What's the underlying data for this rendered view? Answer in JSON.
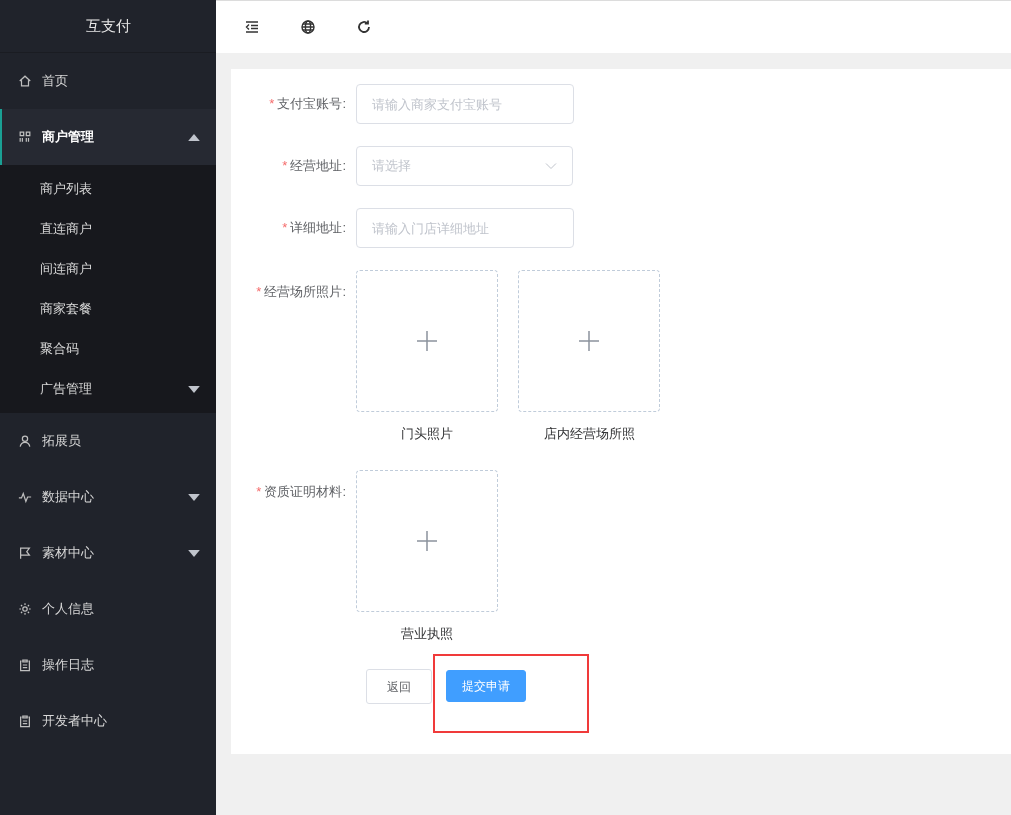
{
  "app": {
    "title": "互支付"
  },
  "sidebar": {
    "items": [
      {
        "label": "首页",
        "selected": false
      },
      {
        "label": "商户管理",
        "selected": true,
        "expanded": true,
        "children": [
          {
            "label": "商户列表"
          },
          {
            "label": "直连商户"
          },
          {
            "label": "间连商户"
          },
          {
            "label": "商家套餐"
          },
          {
            "label": "聚合码"
          },
          {
            "label": "广告管理",
            "expanded": false
          }
        ]
      },
      {
        "label": "拓展员",
        "selected": false
      },
      {
        "label": "数据中心",
        "selected": false,
        "expanded": false
      },
      {
        "label": "素材中心",
        "selected": false,
        "expanded": false
      },
      {
        "label": "个人信息",
        "selected": false
      },
      {
        "label": "操作日志",
        "selected": false
      },
      {
        "label": "开发者中心",
        "selected": false
      }
    ]
  },
  "form": {
    "fields": [
      {
        "kind": "input",
        "mark": "*",
        "label": "支付宝账号:",
        "placeholder": "请输入商家支付宝账号"
      },
      {
        "kind": "select",
        "mark": "*",
        "label": "经营地址:",
        "placeholder": "请选择"
      },
      {
        "kind": "input",
        "mark": "*",
        "label": "详细地址:",
        "placeholder": "请输入门店详细地址"
      },
      {
        "kind": "upload",
        "mark": "*",
        "label": "经营场所照片:",
        "uploads": [
          {
            "caption": "门头照片"
          },
          {
            "caption": "店内经营场所照"
          }
        ]
      },
      {
        "kind": "upload",
        "mark": "*",
        "label": "资质证明材料:",
        "uploads": [
          {
            "caption": "营业执照"
          }
        ]
      }
    ],
    "buttons": [
      {
        "label": "返回",
        "kind": "default",
        "highlighted": false
      },
      {
        "label": "提交申请",
        "kind": "primary",
        "highlighted": true
      }
    ]
  }
}
